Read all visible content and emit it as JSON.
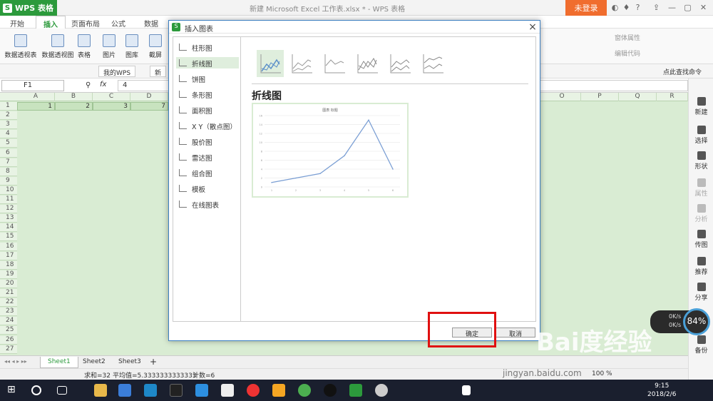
{
  "app": {
    "logo": "WPS 表格",
    "doc_title": "新建 Microsoft Excel 工作表.xlsx * - WPS 表格",
    "login": "未登录"
  },
  "tabs": [
    "开始",
    "插入",
    "页面布局",
    "公式",
    "数据"
  ],
  "ribbon": {
    "items": [
      "数据透视表",
      "数据透视图",
      "表格",
      "图片",
      "图库",
      "截屏"
    ],
    "right_items": [
      "窗体属性",
      "编辑代码"
    ]
  },
  "quickbar": {
    "doc_tabs": [
      "我的WPS",
      "新"
    ],
    "search": "点此查找命令"
  },
  "formula": {
    "cell_ref": "F1",
    "fx": "fx",
    "value": "4"
  },
  "grid": {
    "columns": [
      "A",
      "B",
      "C",
      "D",
      "O",
      "P",
      "Q",
      "R"
    ],
    "rows": [
      "1",
      "2",
      "3",
      "4",
      "5",
      "6",
      "7",
      "8",
      "9",
      "10",
      "11",
      "12",
      "13",
      "14",
      "15",
      "16",
      "17",
      "18",
      "19",
      "20",
      "21",
      "22",
      "23",
      "24",
      "25",
      "26",
      "27"
    ],
    "row1_values": [
      "1",
      "2",
      "3",
      "7"
    ]
  },
  "sheets": [
    "Sheet1",
    "Sheet2",
    "Sheet3",
    "+"
  ],
  "status": {
    "sum": "求和=32",
    "avg": "平均值=5.3333333333333",
    "count": "计数=6",
    "zoom": "100 %"
  },
  "right_panel": [
    "新建",
    "选择",
    "形状",
    "属性",
    "分析",
    "传图",
    "推荐",
    "分享",
    "备份"
  ],
  "dialog": {
    "title": "插入图表",
    "chart_types": [
      "柱形图",
      "折线图",
      "饼图",
      "条形图",
      "面积图",
      "X Y（散点图）",
      "股价图",
      "雷达图",
      "组合图",
      "模板",
      "在线图表"
    ],
    "selected_type": "折线图",
    "heading": "折线图",
    "preview_title": "图表 标题",
    "ok": "确定",
    "cancel": "取消"
  },
  "chart_data": {
    "type": "line",
    "title": "图表 标题",
    "categories": [
      "1",
      "2",
      "3",
      "4",
      "5",
      "6"
    ],
    "values": [
      1,
      2,
      3,
      7,
      15,
      4
    ],
    "ylim": [
      0,
      16
    ],
    "yticks": [
      "0",
      "2",
      "4",
      "6",
      "8",
      "10",
      "12",
      "14",
      "16"
    ],
    "color": "#7b9fd4",
    "grid": true
  },
  "net_widget": {
    "up": "0K/s",
    "down": "0K/s",
    "percent": "84%"
  },
  "watermark": {
    "brand": "Bai度经验",
    "url": "jingyan.baidu.com"
  },
  "taskbar": {
    "time": "9:15",
    "date": "2018/2/6"
  },
  "colors": {
    "wps_green": "#2c9a3c",
    "login_orange": "#f06d2e",
    "highlight_red": "#e01010",
    "dialog_border": "#3c7fc1"
  }
}
